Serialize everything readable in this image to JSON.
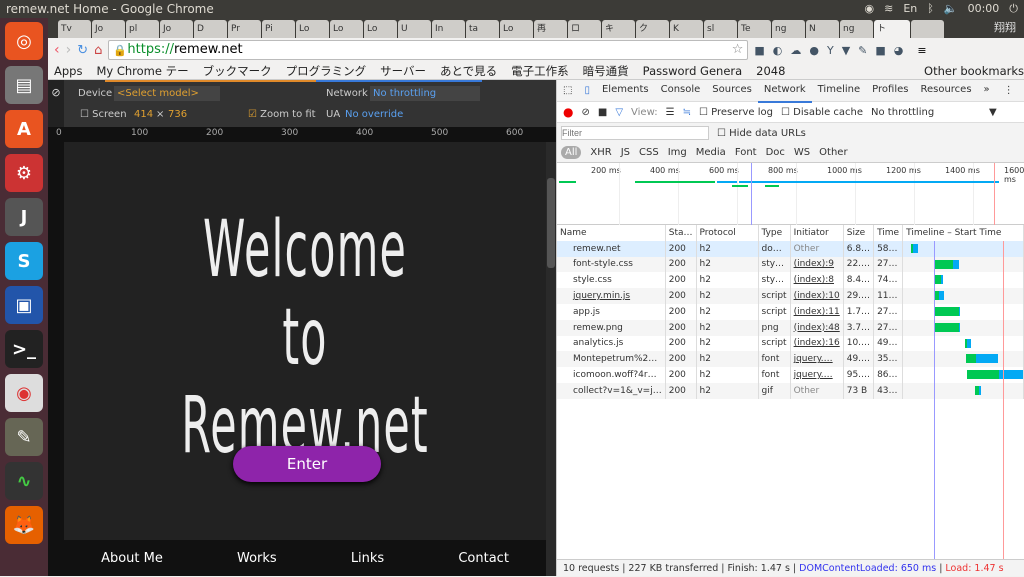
{
  "window": {
    "title": "remew.net Home - Google Chrome",
    "lang": "En",
    "clock": "00:00",
    "ime": "翔翔"
  },
  "tabs": [
    "Tv",
    "Jo",
    "pl",
    "Jo",
    "D",
    "Pr",
    "Pi",
    "Lo",
    "Lo",
    "Lo",
    "U",
    "In",
    "ta",
    "Lo",
    "再",
    "ロ",
    "キ",
    "ク",
    "K",
    "sl",
    "Te",
    "ng",
    "N",
    "ng",
    "ト",
    ""
  ],
  "address": {
    "scheme": "https://",
    "host": "remew.net"
  },
  "bookmarks": [
    "Apps",
    "My Chrome テー",
    "ブックマーク",
    "プログラミング",
    "サーバー",
    "あとで見る",
    "電子工作系",
    "暗号通貨",
    "Password Genera",
    "2048",
    "Other bookmarks"
  ],
  "emulation": {
    "device_label": "Device",
    "device_value": "<Select model>",
    "network_label": "Network",
    "network_value": "No throttling",
    "screen_label": "Screen",
    "width": "414",
    "x": "×",
    "height": "736",
    "zoom_label": "Zoom to fit",
    "ua_label": "UA",
    "ua_value": "No override",
    "ruler": [
      "0",
      "100",
      "200",
      "300",
      "400",
      "500",
      "600"
    ]
  },
  "page": {
    "line1": "Welcome",
    "line2": "to",
    "line3": "Remew.net",
    "enter": "Enter",
    "nav": [
      "About Me",
      "Works",
      "Links",
      "Contact"
    ],
    "accent": "#8e24aa"
  },
  "devtools": {
    "tabs": [
      "Elements",
      "Console",
      "Sources",
      "Network",
      "Timeline",
      "Profiles",
      "Resources",
      "»"
    ],
    "view_label": "View:",
    "preserve_log": "Preserve log",
    "disable_cache": "Disable cache",
    "throttling": "No throttling",
    "filter_placeholder": "Filter",
    "hide_data_urls": "Hide data URLs",
    "types": [
      "All",
      "XHR",
      "JS",
      "CSS",
      "Img",
      "Media",
      "Font",
      "Doc",
      "WS",
      "Other"
    ],
    "overview_ticks": [
      "200 ms",
      "400 ms",
      "600 ms",
      "800 ms",
      "1000 ms",
      "1200 ms",
      "1400 ms",
      "1600 ms"
    ],
    "columns": [
      "Name",
      "Sta…",
      "Protocol",
      "Type",
      "Initiator",
      "Size",
      "Time",
      "Timeline – Start Time"
    ],
    "rows": [
      [
        "remew.net",
        "200",
        "h2",
        "do…",
        "Other",
        "6.8…",
        "58…"
      ],
      [
        "font-style.css",
        "200",
        "h2",
        "sty…",
        "(index):9",
        "22.…",
        "27…"
      ],
      [
        "style.css",
        "200",
        "h2",
        "sty…",
        "(index):8",
        "8.4…",
        "74…"
      ],
      [
        "jquery.min.js",
        "200",
        "h2",
        "script",
        "(index):10",
        "29.…",
        "11…"
      ],
      [
        "app.js",
        "200",
        "h2",
        "script",
        "(index):11",
        "1.7…",
        "27…"
      ],
      [
        "remew.png",
        "200",
        "h2",
        "png",
        "(index):48",
        "3.7…",
        "27…"
      ],
      [
        "analytics.js",
        "200",
        "h2",
        "script",
        "(index):16",
        "10.…",
        "49…"
      ],
      [
        "Montepetrum%2…",
        "200",
        "h2",
        "font",
        "jquery.…",
        "49.…",
        "35…"
      ],
      [
        "icomoon.woff?4r…",
        "200",
        "h2",
        "font",
        "jquery.…",
        "95.…",
        "86…"
      ],
      [
        "collect?v=1&_v=j…",
        "200",
        "h2",
        "gif",
        "Other",
        "73 B",
        "43…"
      ]
    ],
    "status": {
      "requests": "10 requests",
      "transferred": "227 KB transferred",
      "finish": "Finish: 1.47 s",
      "dcl": "DOMContentLoaded: 650 ms",
      "load": "Load: 1.47 s"
    },
    "colors": {
      "waiting": "#00c853",
      "download": "#03a9f4",
      "dcl": "#6d6dff",
      "load": "#ff6b6b"
    }
  }
}
